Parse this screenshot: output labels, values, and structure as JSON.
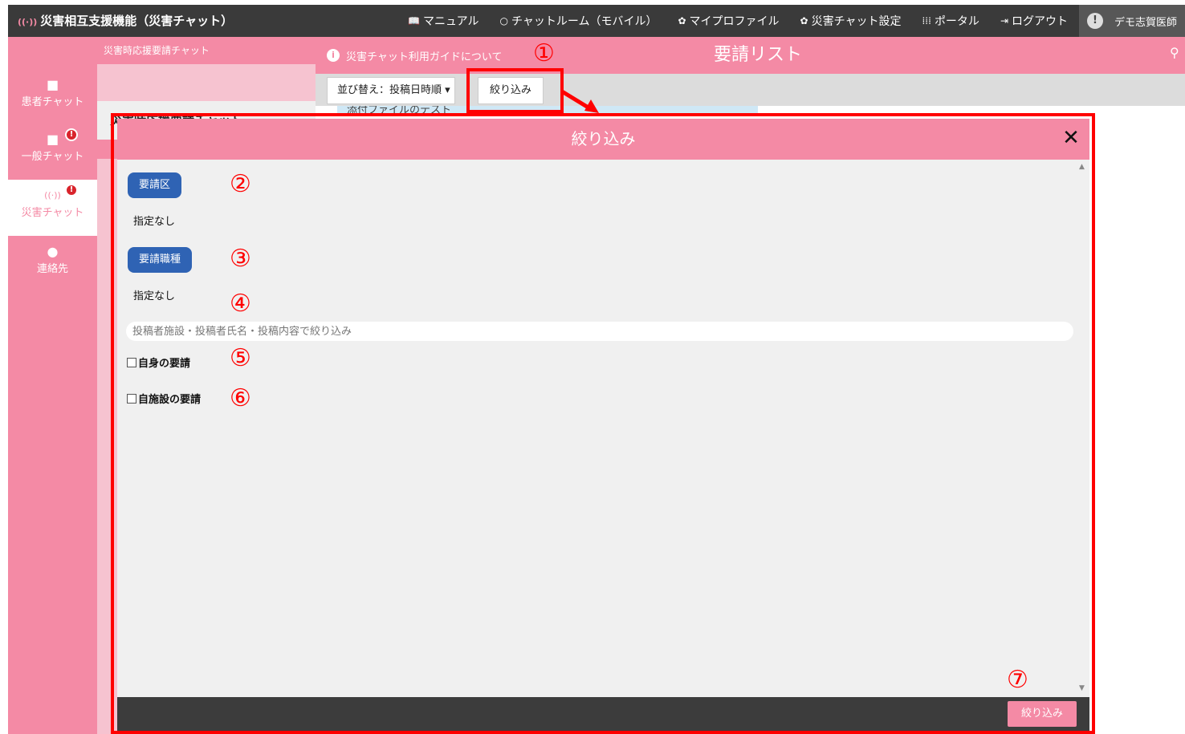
{
  "topbar": {
    "brand": "災害相互支援機能（災害チャット）",
    "nav": [
      {
        "icon": "📖",
        "icon_name": "book-icon",
        "label": "マニュアル"
      },
      {
        "icon": "○",
        "icon_name": "refresh-icon",
        "label": "チャットルーム（モバイル）"
      },
      {
        "icon": "✿",
        "icon_name": "gear-icon",
        "label": "マイプロファイル"
      },
      {
        "icon": "✿",
        "icon_name": "gear-icon",
        "label": "災害チャット設定"
      },
      {
        "icon": "⁞⁞⁞",
        "icon_name": "grid-icon",
        "label": "ポータル"
      },
      {
        "icon": "⇥",
        "icon_name": "logout-icon",
        "label": "ログアウト"
      }
    ],
    "user_name": "デモ志賀医師"
  },
  "rail": {
    "items": [
      {
        "label": "患者チャット",
        "icon": "■",
        "badge": ""
      },
      {
        "label": "一般チャット",
        "icon": "■",
        "badge": "!"
      },
      {
        "label": "災害チャット",
        "icon": "((·))",
        "badge": "!"
      },
      {
        "label": "連絡先",
        "icon": "●",
        "badge": ""
      }
    ]
  },
  "chatlist": {
    "header": "災害時応援要請チャット",
    "selected": "災害時応援要請チャット"
  },
  "main": {
    "guide_link": "災害チャット利用ガイドについて",
    "title": "要請リスト",
    "sort_label": "並び替え：投稿日時順 ▾",
    "filter_label": "絞り込み",
    "strip_text": "添付ファイルのテスト"
  },
  "modal": {
    "title": "絞り込み",
    "close": "✕",
    "area_button": "要請区",
    "area_value": "指定なし",
    "job_button": "要請職種",
    "job_value": "指定なし",
    "search_placeholder": "投稿者施設・投稿者氏名・投稿内容で絞り込み",
    "own_requests_label": "自身の要請",
    "own_facility_label": "自施設の要請",
    "apply_button": "絞り込み"
  },
  "annotations": [
    "①",
    "②",
    "③",
    "④",
    "⑤",
    "⑥",
    "⑦"
  ],
  "colors": {
    "accent_pink": "#f48aa5",
    "topbar_dark": "#3a3a3a",
    "button_blue": "#2f63b4",
    "highlight_red": "#ff0000"
  }
}
